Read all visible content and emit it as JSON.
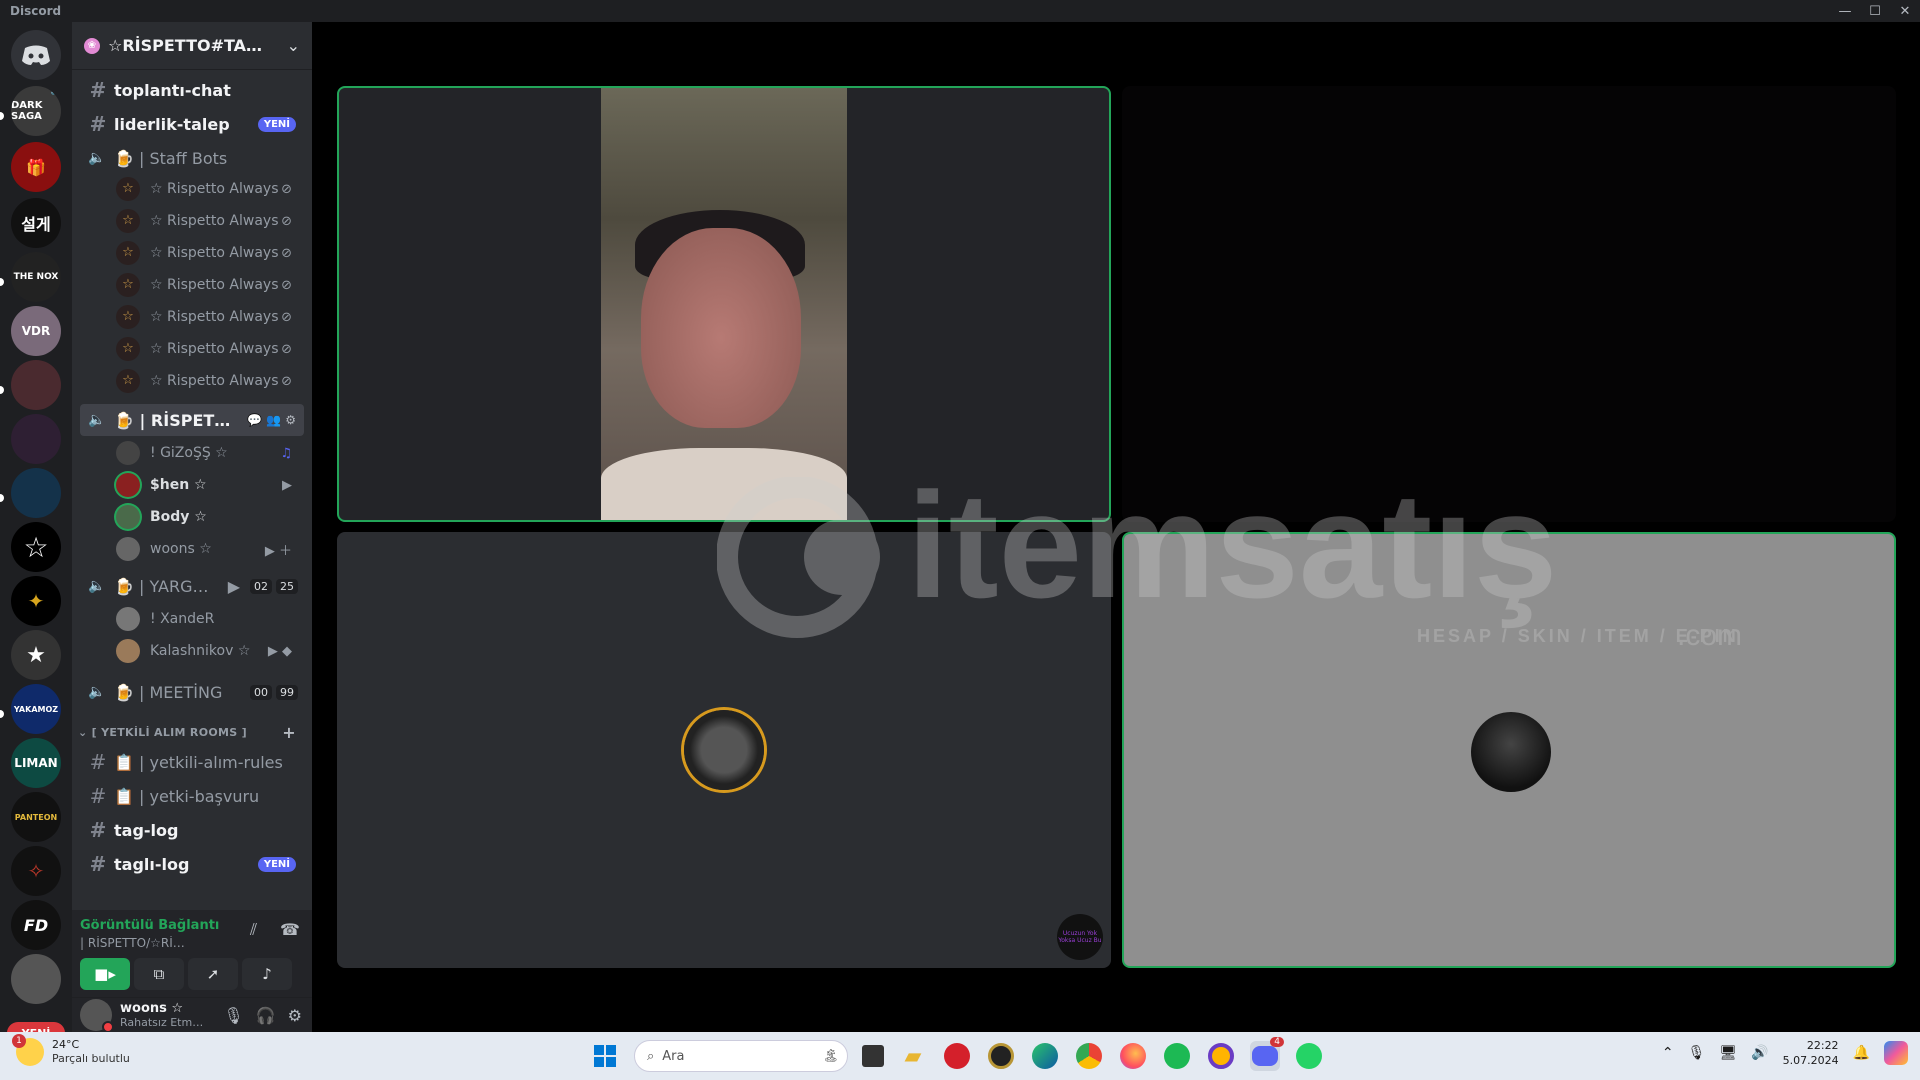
{
  "window": {
    "title": "Discord",
    "min": "—",
    "max": "☐",
    "close": "✕"
  },
  "server": {
    "name": "☆RİSPETTO#TA…",
    "new_badge": "YENİ"
  },
  "channels": {
    "top_dots": "· ·",
    "toplanti": "toplantı-chat",
    "liderlik": "liderlik-talep",
    "liderlik_tag": "YENİ",
    "staff_bots": "| Staff Bots",
    "bot_name": "☆ Rispetto Always",
    "rispetto_voice": "| RİSPET…",
    "yarg_voice": "| YARG…",
    "yarg_counts": [
      "02",
      "25"
    ],
    "meeting_voice": "| MEETİNG",
    "meeting_counts": [
      "00",
      "99"
    ],
    "category": "[ YETKİLİ ALIM ROOMS ]",
    "rules": "| yetkili-alım-rules",
    "basvuru": "| yetki-başvuru",
    "taglog": "tag-log",
    "taglilog": "taglı-log",
    "taglilog_tag": "YENİ"
  },
  "voice_users": {
    "u1": "! GiZoŞŞ ☆",
    "u2": "$hen ☆",
    "u3": "Body ☆",
    "u4": "woons ☆",
    "u5": "! XandeR",
    "u6": "Kalashnikov ☆"
  },
  "voice_panel": {
    "status": "Görüntülü Bağlantı Kı",
    "channel": "| RİSPETTO/☆Rİ…"
  },
  "user_panel": {
    "name": "woons ☆",
    "status": "Rahatsız Etm…"
  },
  "tiles": {
    "mini_avatar_text": "Ucuzun Yok Yoksa Ucuz Bu",
    "watermark_text": "itemsatış",
    "watermark_sub": "HESAP / SKIN / ITEM / E-PIN",
    "watermark_com": ".com"
  },
  "taskbar": {
    "temp": "24°C",
    "weather": "Parçalı bulutlu",
    "weather_badge": "1",
    "search_placeholder": "Ara",
    "discord_badge": "4",
    "time": "22:22",
    "date": "5.07.2024"
  },
  "guild_icons": {
    "g3": "설게",
    "g4": "THE NOX",
    "g10": "PANTEON",
    "g11": "FD",
    "g5": "VDR",
    "g12": "LIMAN"
  }
}
